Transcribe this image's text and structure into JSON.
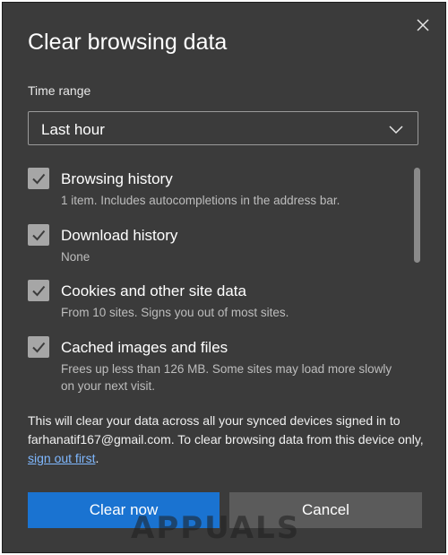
{
  "dialog": {
    "title": "Clear browsing data",
    "close_icon": "close-icon"
  },
  "time_range": {
    "label": "Time range",
    "selected": "Last hour"
  },
  "items": [
    {
      "label": "Browsing history",
      "description": "1 item. Includes autocompletions in the address bar.",
      "checked": true
    },
    {
      "label": "Download history",
      "description": "None",
      "checked": true
    },
    {
      "label": "Cookies and other site data",
      "description": "From 10 sites. Signs you out of most sites.",
      "checked": true
    },
    {
      "label": "Cached images and files",
      "description": "Frees up less than 126 MB. Some sites may load more slowly on your next visit.",
      "checked": true
    }
  ],
  "note": {
    "text": "This will clear your data across all your synced devices signed in to farhanatif167@gmail.com. To clear browsing data from this device only,",
    "link": "sign out first",
    "end": "."
  },
  "buttons": {
    "primary": "Clear now",
    "secondary": "Cancel"
  },
  "watermark": "APPUALS",
  "colors": {
    "background": "#3b3b3b",
    "primary": "#1a73d1",
    "secondary": "#5b5b5b",
    "link": "#7fb8ff"
  }
}
